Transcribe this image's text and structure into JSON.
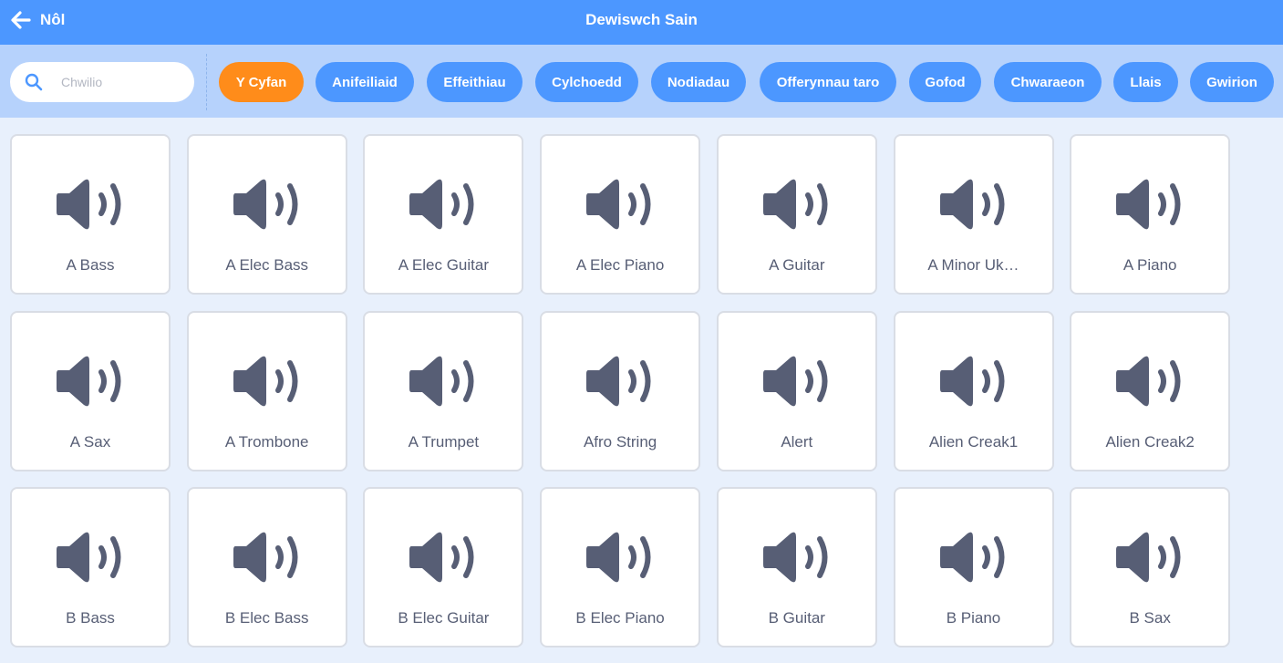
{
  "header": {
    "back_label": "Nôl",
    "title": "Dewiswch Sain"
  },
  "search": {
    "placeholder": "Chwilio",
    "value": ""
  },
  "tags": [
    {
      "label": "Y Cyfan",
      "active": true
    },
    {
      "label": "Anifeiliaid",
      "active": false
    },
    {
      "label": "Effeithiau",
      "active": false
    },
    {
      "label": "Cylchoedd",
      "active": false
    },
    {
      "label": "Nodiadau",
      "active": false
    },
    {
      "label": "Offerynnau taro",
      "active": false
    },
    {
      "label": "Gofod",
      "active": false
    },
    {
      "label": "Chwaraeon",
      "active": false
    },
    {
      "label": "Llais",
      "active": false
    },
    {
      "label": "Gwirion",
      "active": false
    }
  ],
  "sounds": [
    {
      "name": "A Bass"
    },
    {
      "name": "A Elec Bass"
    },
    {
      "name": "A Elec Guitar"
    },
    {
      "name": "A Elec Piano"
    },
    {
      "name": "A Guitar"
    },
    {
      "name": "A Minor Uk…"
    },
    {
      "name": "A Piano"
    },
    {
      "name": "A Sax"
    },
    {
      "name": "A Trombone"
    },
    {
      "name": "A Trumpet"
    },
    {
      "name": "Afro String"
    },
    {
      "name": "Alert"
    },
    {
      "name": "Alien Creak1"
    },
    {
      "name": "Alien Creak2"
    },
    {
      "name": "B Bass"
    },
    {
      "name": "B Elec Bass"
    },
    {
      "name": "B Elec Guitar"
    },
    {
      "name": "B Elec Piano"
    },
    {
      "name": "B Guitar"
    },
    {
      "name": "B Piano"
    },
    {
      "name": "B Sax"
    }
  ],
  "icons": {
    "back": "back-arrow-icon",
    "search": "search-icon",
    "sound": "speaker-icon"
  },
  "colors": {
    "header": "#4c97ff",
    "filterbar": "#b6d2fc",
    "tag": "#4c97ff",
    "tag_active": "#ff8c1a",
    "icon": "#575e75"
  }
}
